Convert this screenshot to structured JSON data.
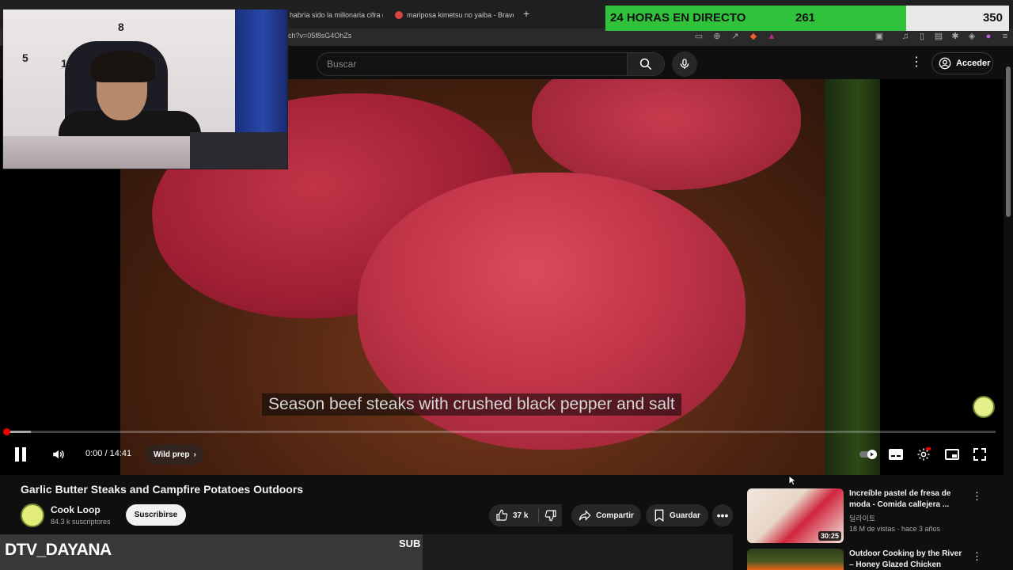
{
  "browser": {
    "tabs": [
      {
        "label": "habría sido la millonaria cifra qu"
      },
      {
        "label": "mariposa kimetsu no yaiba - Brave Se"
      }
    ],
    "new_tab": "+",
    "url": "ch?v=05f8sG4OhZs"
  },
  "goal_bar": {
    "label": "24 HORAS EN DIRECTO",
    "current": "261",
    "max": "350",
    "progress": 0.7457,
    "fill_color": "#2fc23a"
  },
  "header": {
    "search_placeholder": "Buscar",
    "signin_label": "Acceder",
    "icons": [
      "search-icon",
      "mic-icon",
      "more-icon",
      "account-icon"
    ]
  },
  "player": {
    "caption": "Season beef steaks with crushed black pepper and salt",
    "time": "0:00 / 14:41",
    "chapter": "Wild prep",
    "progress": 0.0,
    "buffered": 0.025,
    "accent": "#ff0000"
  },
  "video": {
    "title": "Garlic Butter Steaks and Campfire Potatoes Outdoors",
    "channel": "Cook Loop",
    "subscribers": "84.3 k suscriptores",
    "subscribe_label": "Suscribirse",
    "likes": "37 k",
    "share_label": "Compartir",
    "save_label": "Guardar"
  },
  "recommendations": [
    {
      "title": "Increíble pastel de fresa de moda - Comida callejera ...",
      "channel": "딜라이트",
      "meta": "18 M de vistas · hace 3 años",
      "duration": "30:25"
    },
    {
      "title": "Outdoor Cooking by the River – Honey Glazed Chicken Thighs ...",
      "channel": "",
      "meta": "",
      "duration": ""
    }
  ],
  "stream_overlay": {
    "name": "DTV_DAYANA",
    "sub_label": "SUB"
  },
  "webcam": {
    "clock_numbers": [
      "8",
      "5",
      "1"
    ]
  }
}
